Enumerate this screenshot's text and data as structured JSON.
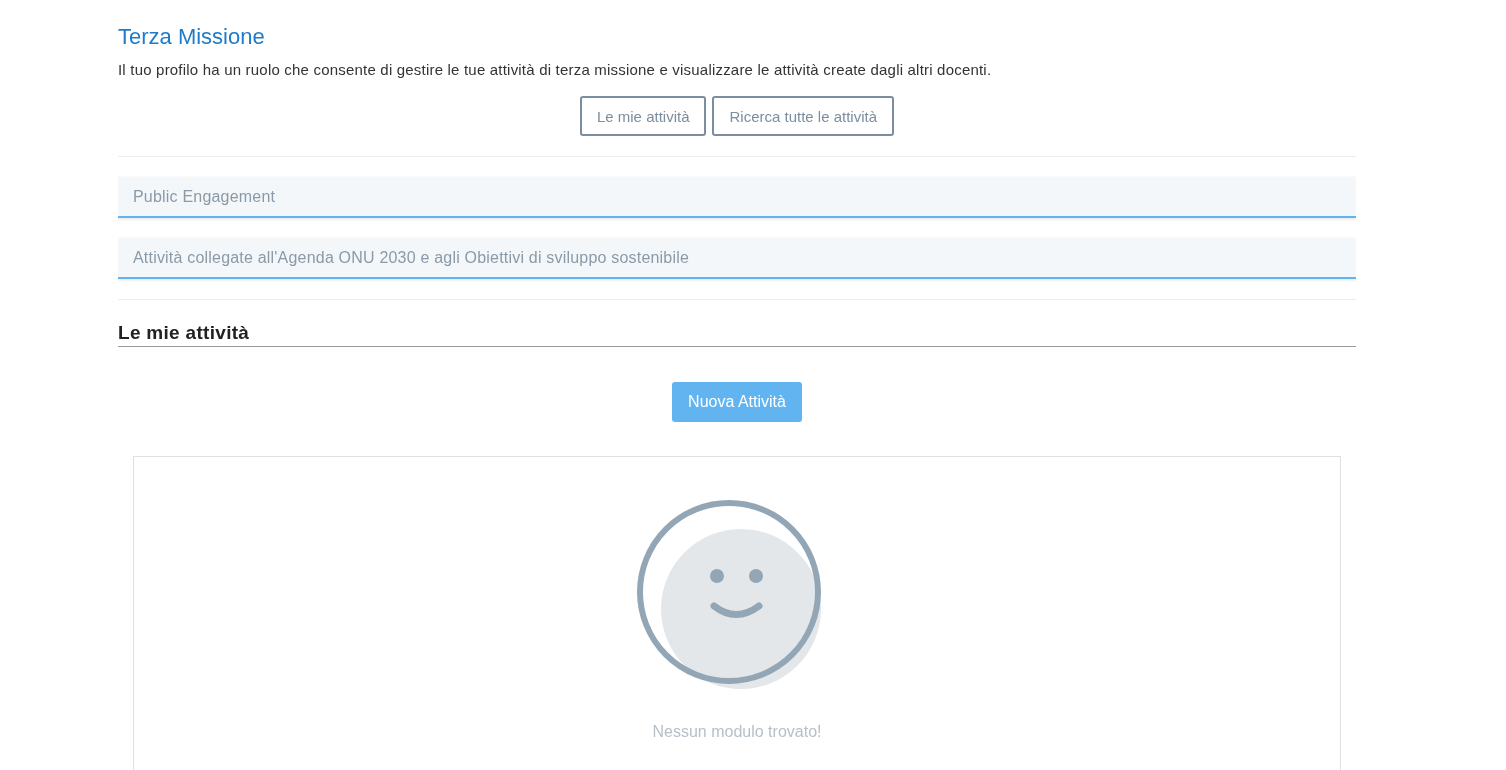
{
  "title": "Terza Missione",
  "description": "Il tuo profilo ha un ruolo che consente di gestire le tue attività di terza missione e visualizzare le attività create dagli altri docenti.",
  "view_buttons": [
    "Le mie attività",
    "Ricerca tutte le attività"
  ],
  "accordions": [
    {
      "label": "Public Engagement"
    },
    {
      "label": "Attività collegate all'Agenda ONU 2030 e agli Obiettivi di sviluppo sostenibile"
    }
  ],
  "section_title": "Le mie attività",
  "new_button": "Nuova Attività",
  "empty_message": "Nessun modulo trovato!"
}
